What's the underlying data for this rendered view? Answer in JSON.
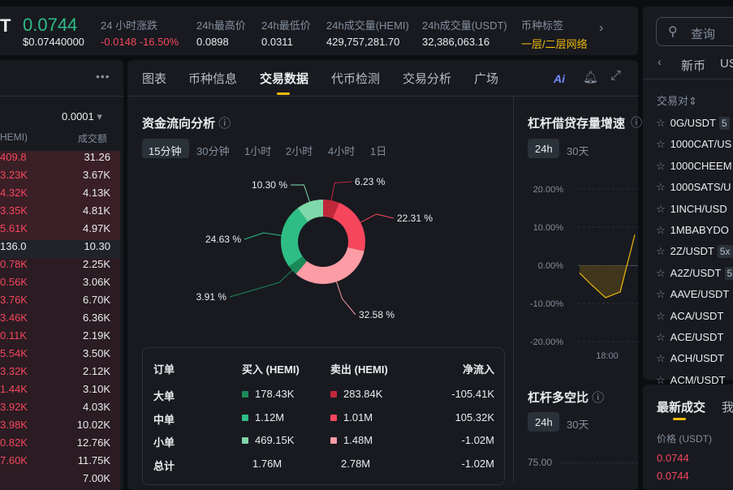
{
  "ticker": {
    "symbol_fragment": "T",
    "price": "0.0744",
    "price_usd": "$0.07440000",
    "stats": [
      {
        "label": "24 小时涨跌",
        "value": "-0.0148 -16.50%"
      },
      {
        "label": "24h最高价",
        "value": "0.0898"
      },
      {
        "label": "24h最低价",
        "value": "0.0311"
      },
      {
        "label": "24h成交量(HEMI)",
        "value": "429,757,281.70"
      },
      {
        "label": "24h成交量(USDT)",
        "value": "32,386,063.16"
      },
      {
        "label": "币种标签",
        "value": "一层/二层网络"
      }
    ]
  },
  "orderbook": {
    "precision": "0.0001",
    "col_amount": "HEMI)",
    "col_total": "成交额",
    "asks": [
      [
        "409.8",
        "31.26"
      ],
      [
        "3.23K",
        "3.67K"
      ],
      [
        "4.32K",
        "4.13K"
      ],
      [
        "3.35K",
        "4.81K"
      ],
      [
        "5.61K",
        "4.97K"
      ]
    ],
    "mid": [
      "136.0",
      "10.30"
    ],
    "bids": [
      [
        "0.78K",
        "2.25K"
      ],
      [
        "0.56K",
        "3.06K"
      ],
      [
        "3.76K",
        "6.70K"
      ],
      [
        "3.46K",
        "6.36K"
      ],
      [
        "0.11K",
        "2.19K"
      ],
      [
        "5.54K",
        "3.50K"
      ],
      [
        "3.32K",
        "2.12K"
      ],
      [
        "1.44K",
        "3.10K"
      ],
      [
        "3.92K",
        "4.03K"
      ],
      [
        "3.98K",
        "10.02K"
      ],
      [
        "0.82K",
        "12.76K"
      ],
      [
        "7.60K",
        "11.75K"
      ],
      [
        "",
        "7.00K"
      ]
    ]
  },
  "tabs": [
    "图表",
    "币种信息",
    "交易数据",
    "代币检测",
    "交易分析",
    "广场"
  ],
  "ai_label": "Ai",
  "fund_flow": {
    "title": "资金流向分析",
    "timeframes": [
      "15分钟",
      "30分钟",
      "1小时",
      "2小时",
      "4小时",
      "1日"
    ],
    "slices": [
      {
        "label": "6.23 %",
        "value": 6.23,
        "color": "#c0283c"
      },
      {
        "label": "22.31 %",
        "value": 22.31,
        "color": "#f6465d"
      },
      {
        "label": "32.58 %",
        "value": 32.58,
        "color": "#fc9ca4"
      },
      {
        "label": "3.91 %",
        "value": 3.91,
        "color": "#1a8a58"
      },
      {
        "label": "24.63 %",
        "value": 24.63,
        "color": "#2ebd85"
      },
      {
        "label": "10.30 %",
        "value": 10.3,
        "color": "#7fd8aa"
      }
    ]
  },
  "flow_table": {
    "headers": [
      "订单",
      "买入 (HEMI)",
      "卖出 (HEMI)",
      "净流入"
    ],
    "rows": [
      {
        "name": "大单",
        "buy": "178.43K",
        "sell": "283.84K",
        "net": "-105.41K",
        "bc": "#1a8a58",
        "sc": "#c0283c"
      },
      {
        "name": "中单",
        "buy": "1.12M",
        "sell": "1.01M",
        "net": "105.32K",
        "bc": "#2ebd85",
        "sc": "#f6465d"
      },
      {
        "name": "小单",
        "buy": "469.15K",
        "sell": "1.48M",
        "net": "-1.02M",
        "bc": "#7fd8aa",
        "sc": "#fc9ca4"
      },
      {
        "name": "总计",
        "buy": "1.76M",
        "sell": "2.78M",
        "net": "-1.02M"
      }
    ]
  },
  "margin_loan": {
    "title": "杠杆借贷存量增速",
    "timeframes": [
      "24h",
      "30天"
    ],
    "yticks": [
      "20.00%",
      "10.00%",
      "0.00%",
      "-10.00%",
      "-20.00%"
    ],
    "xtick": "18:00"
  },
  "long_short": {
    "title": "杠杆多空比",
    "timeframes": [
      "24h",
      "30天"
    ],
    "ytick": "75.00"
  },
  "chart_data": {
    "type": "area",
    "title": "杠杆借贷存量增速",
    "x": [
      "",
      "",
      "",
      "18:00",
      ""
    ],
    "y": [
      -2,
      -5,
      -8.5,
      -7,
      8
    ],
    "ylim": [
      -20,
      20
    ]
  },
  "right": {
    "search_placeholder": "查询",
    "tabs": [
      "新币",
      "US"
    ],
    "col_pair": "交易对",
    "pairs": [
      [
        "0G/USDT",
        "5"
      ],
      [
        "1000CAT/US",
        ""
      ],
      [
        "1000CHEEM",
        ""
      ],
      [
        "1000SATS/U",
        ""
      ],
      [
        "1INCH/USD",
        ""
      ],
      [
        "1MBABYDO",
        ""
      ],
      [
        "2Z/USDT",
        "5x"
      ],
      [
        "A2Z/USDT",
        "5"
      ],
      [
        "AAVE/USDT",
        ""
      ],
      [
        "ACA/USDT",
        ""
      ],
      [
        "ACE/USDT",
        ""
      ],
      [
        "ACH/USDT",
        ""
      ],
      [
        "ACM/USDT",
        ""
      ]
    ],
    "trades_tab": "最新成交",
    "trades_tab2": "我",
    "price_col": "价格 (USDT)",
    "prices": [
      "0.0744",
      "0.0744"
    ]
  }
}
